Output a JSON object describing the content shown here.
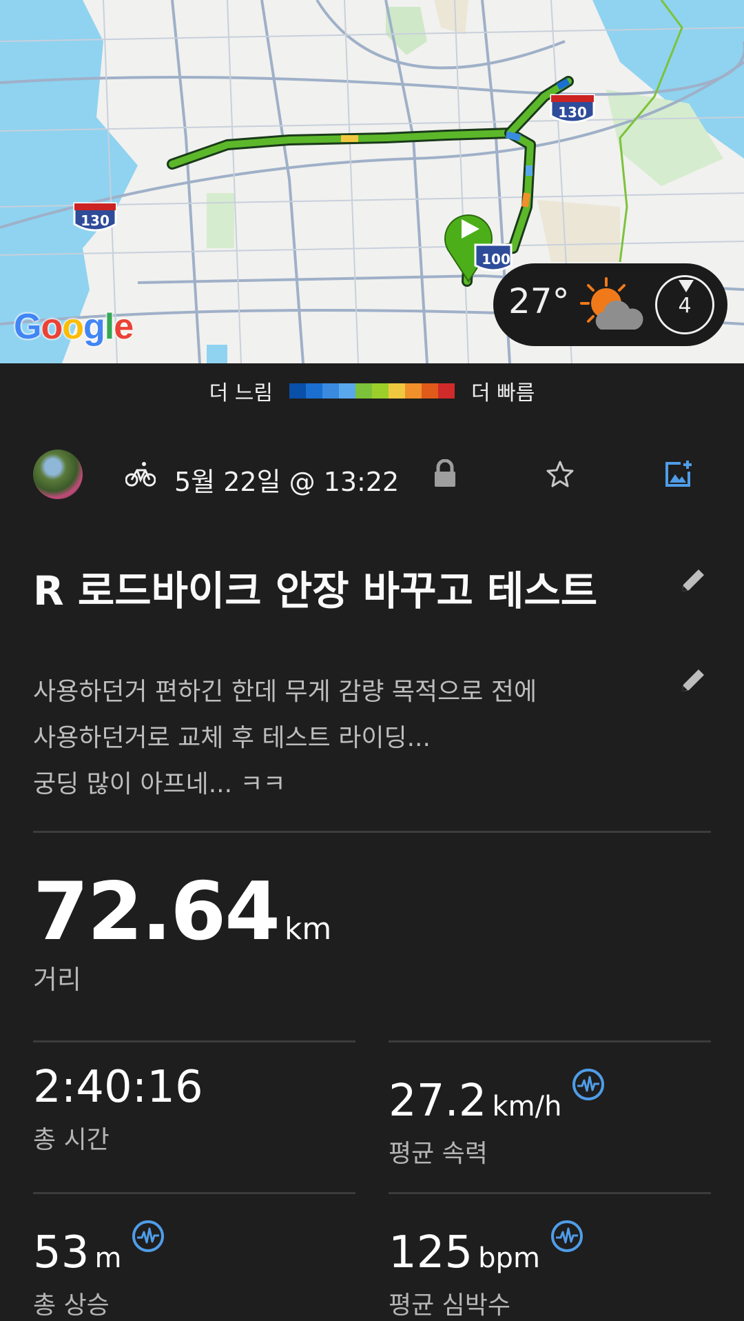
{
  "map": {
    "route_shields": [
      "130",
      "130",
      "100"
    ],
    "google_logo": "Google",
    "weather": {
      "temperature": "27°",
      "icon": "partly-sunny-cloud-icon",
      "wind_level": "4"
    }
  },
  "legend": {
    "slower_label": "더 느림",
    "faster_label": "더 빠름",
    "colors": [
      "#0a4fa8",
      "#1a6fd0",
      "#3a8be0",
      "#5aa8ec",
      "#7cc23a",
      "#9ccf2a",
      "#f0c840",
      "#f0902a",
      "#e05a1a",
      "#d02a2a"
    ]
  },
  "activity": {
    "type_icon": "bicycle-icon",
    "date": "5월 22일 @ 13:22",
    "title": "R 로드바이크 안장 바꾸고 테스트",
    "description_lines": [
      "사용하던거 편하긴 한데 무게 감량 목적으로 전에",
      "사용하던거로 교체 후 테스트 라이딩...",
      "궁딩 많이 아프네... ㅋㅋ"
    ]
  },
  "stats": {
    "distance": {
      "value": "72.64",
      "unit": "km",
      "label": "거리"
    },
    "total_time": {
      "value": "2:40:16",
      "unit": "",
      "label": "총 시간"
    },
    "avg_speed": {
      "value": "27.2",
      "unit": "km/h",
      "label": "평균 속력"
    },
    "total_ascent": {
      "value": "53",
      "unit": "m",
      "label": "총 상승"
    },
    "avg_hr": {
      "value": "125",
      "unit": "bpm",
      "label": "평균 심박수"
    }
  },
  "colors": {
    "background": "#1e1e1e",
    "accent_blue": "#4f9de8",
    "route_green": "#5cb82a",
    "start_marker": "#4caf1a"
  }
}
